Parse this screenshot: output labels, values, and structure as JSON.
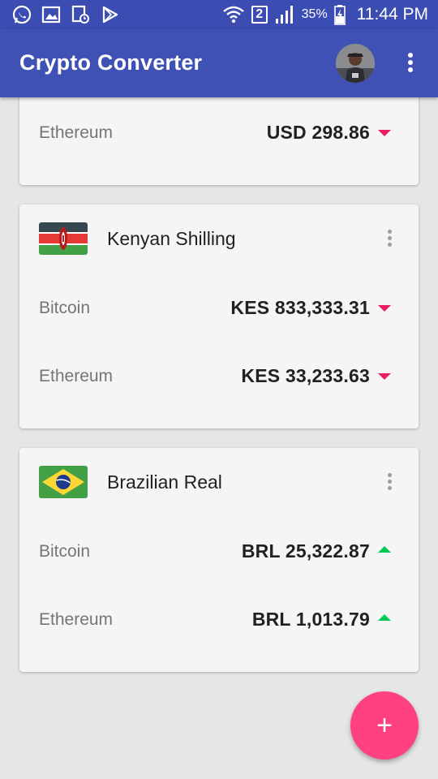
{
  "status_bar": {
    "icons_left": [
      "whatsapp-icon",
      "gallery-icon",
      "doc-clock-icon",
      "play-store-icon"
    ],
    "sim_label": "2",
    "battery_percent": "35%",
    "time": "11:44 PM"
  },
  "app_bar": {
    "title": "Crypto Converter"
  },
  "cards": [
    {
      "currency": "",
      "rows": [
        {
          "coin": "Ethereum",
          "value": "USD 298.86",
          "trend": "down"
        }
      ]
    },
    {
      "currency": "Kenyan Shilling",
      "flag": "kenya-flag-icon",
      "rows": [
        {
          "coin": "Bitcoin",
          "value": "KES 833,333.31",
          "trend": "down"
        },
        {
          "coin": "Ethereum",
          "value": "KES 33,233.63",
          "trend": "down"
        }
      ]
    },
    {
      "currency": "Brazilian Real",
      "flag": "brazil-flag-icon",
      "rows": [
        {
          "coin": "Bitcoin",
          "value": "BRL 25,322.87",
          "trend": "up"
        },
        {
          "coin": "Ethereum",
          "value": "BRL 1,013.79",
          "trend": "up"
        }
      ]
    }
  ],
  "fab": {
    "label": "+"
  },
  "colors": {
    "primary": "#3f51b5",
    "status_bar": "#3b4cb3",
    "accent": "#ff4081",
    "trend_down": "#e91e63",
    "trend_up": "#00c853"
  }
}
